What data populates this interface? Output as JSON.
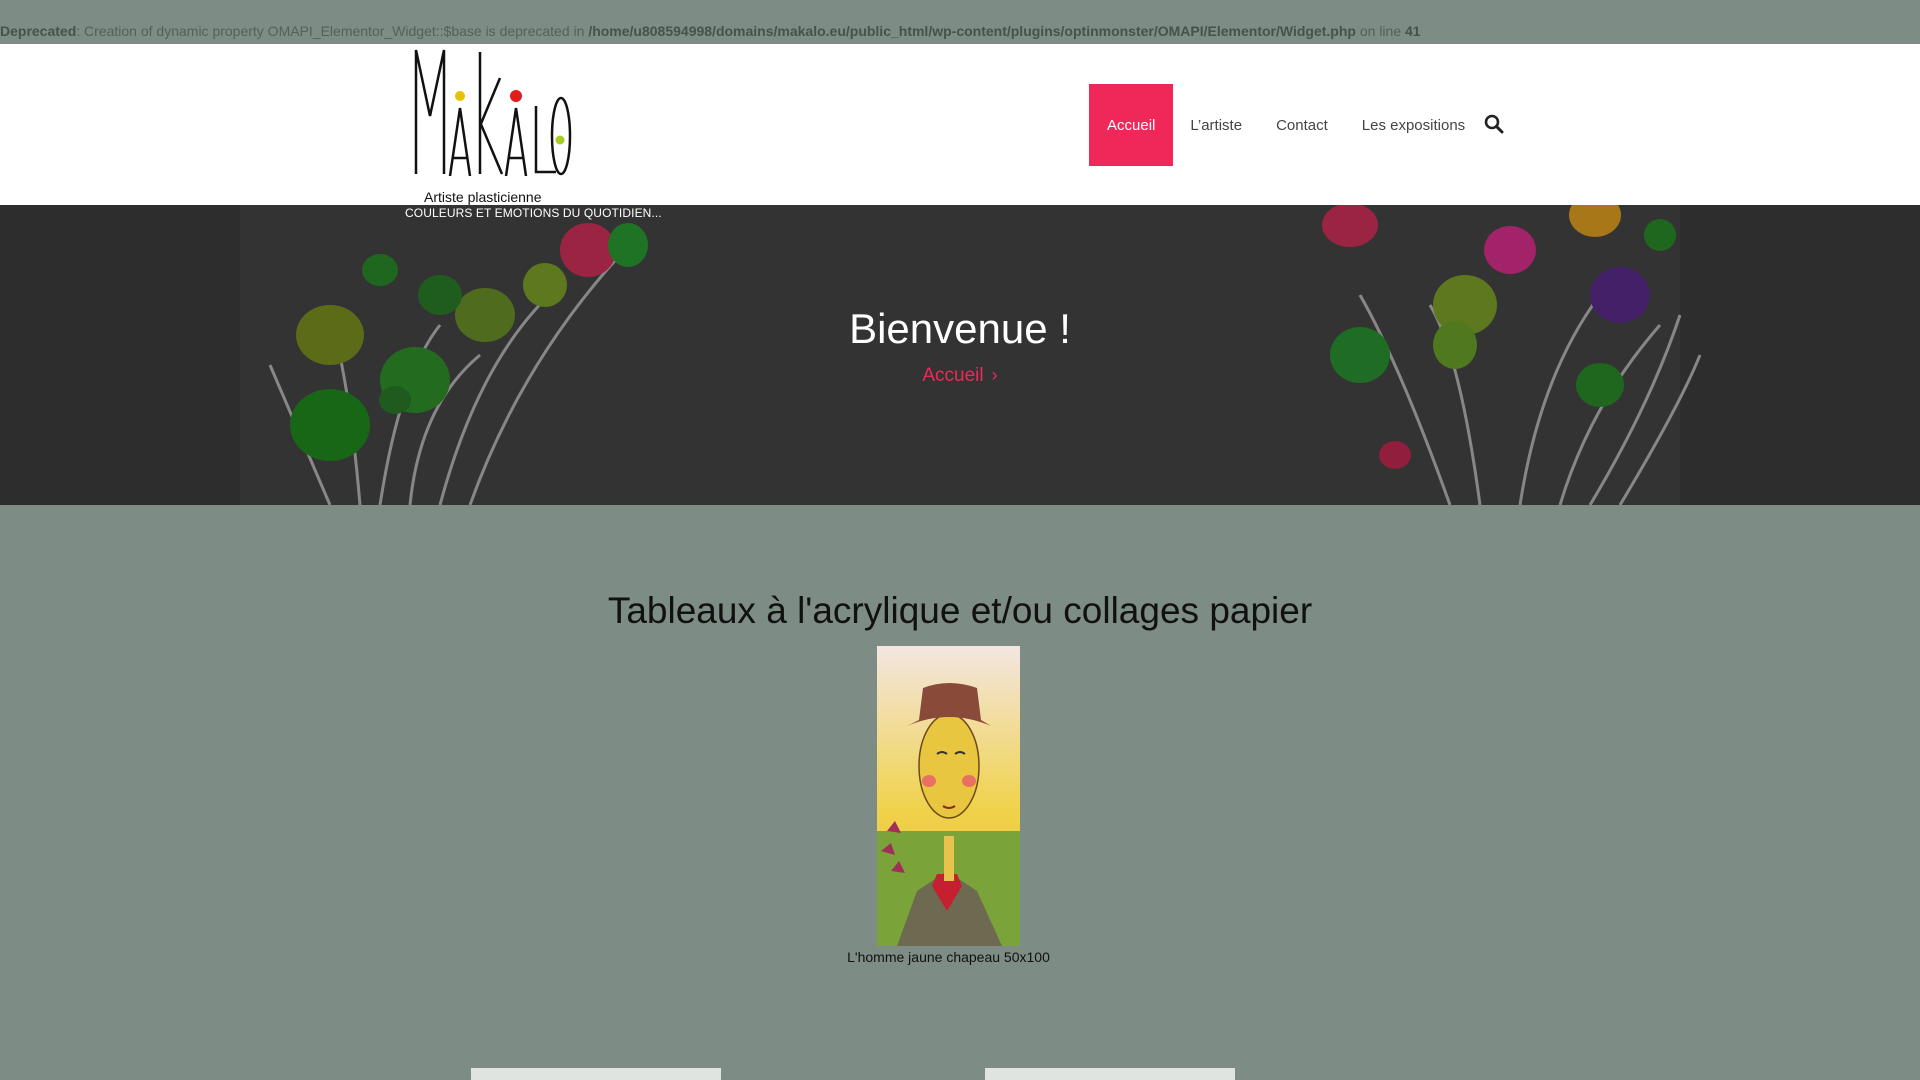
{
  "notice": {
    "label": "Deprecated",
    "message": ": Creation of dynamic property OMAPI_Elementor_Widget::$base is deprecated in ",
    "path": "/home/u808594998/domains/makalo.eu/public_html/wp-content/plugins/optinmonster/OMAPI/Elementor/Widget.php",
    "line_text": " on line ",
    "line_number": "41"
  },
  "logo": {
    "icon": "makalo-logo",
    "subtitle": "Artiste plasticienne"
  },
  "tagline": "COULEURS ET EMOTIONS DU QUOTIDIEN...",
  "nav": {
    "items": [
      {
        "label": "Accueil",
        "active": true
      },
      {
        "label": "L’artiste",
        "active": false
      },
      {
        "label": "Contact",
        "active": false
      },
      {
        "label": "Les expositions",
        "active": false
      }
    ],
    "search_icon": "search-icon"
  },
  "hero": {
    "title": "Bienvenue !",
    "breadcrumb": "Accueil"
  },
  "section": {
    "title": "Tableaux à l'acrylique et/ou collages papier"
  },
  "artwork": {
    "caption": "L'homme jaune chapeau 50x100"
  },
  "colors": {
    "accent": "#f0285a",
    "page_bg": "#7d8c84",
    "header_bg": "#ffffff",
    "hero_bg": "#3b3b3b"
  }
}
